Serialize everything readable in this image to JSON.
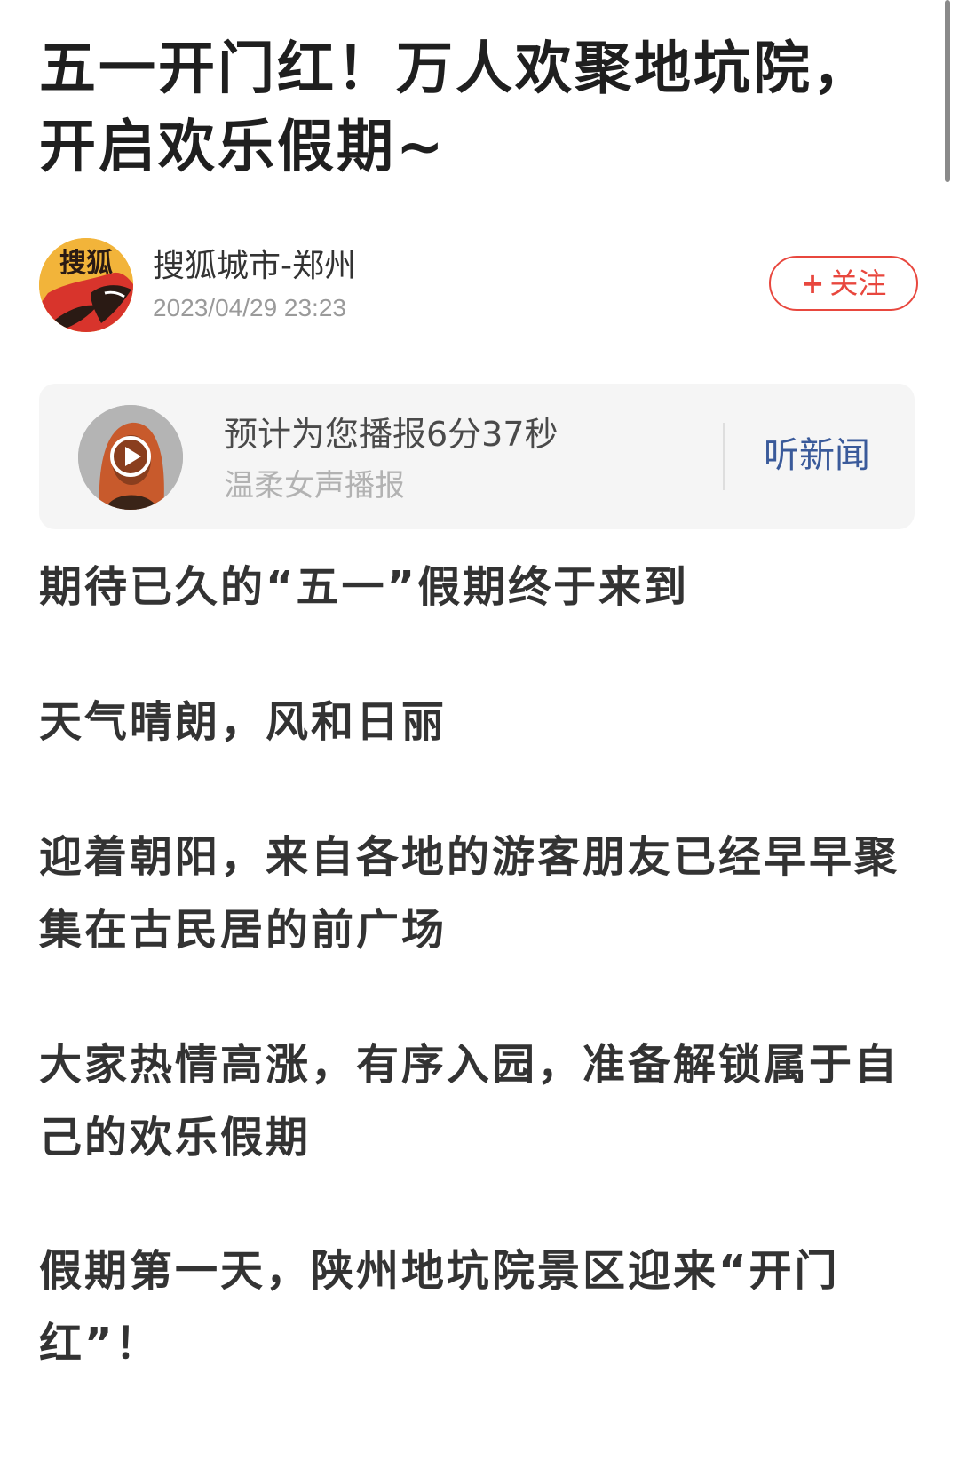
{
  "article": {
    "title": "五一开门红！万人欢聚地坑院，开启欢乐假期~"
  },
  "author": {
    "avatar_text": "搜狐",
    "name": "搜狐城市-郑州",
    "time": "2023/04/29 23:23",
    "follow_plus": "+",
    "follow_label": "关注"
  },
  "audio": {
    "title": "预计为您播报6分37秒",
    "subtitle": "温柔女声播报",
    "listen_label": "听新闻",
    "play_icon": "play-icon"
  },
  "paragraphs": [
    "期待已久的“五一”假期终于来到",
    "天气晴朗，风和日丽",
    "迎着朝阳，来自各地的游客朋友已经早早聚集在古民居的前广场",
    "大家热情高涨，有序入园，准备解锁属于自己的欢乐假期",
    "假期第一天，陕州地坑院景区迎来“开门红”！"
  ],
  "colors": {
    "accent_red": "#e8473e",
    "link_blue": "#3a5a9a",
    "card_bg": "#f5f5f5"
  }
}
